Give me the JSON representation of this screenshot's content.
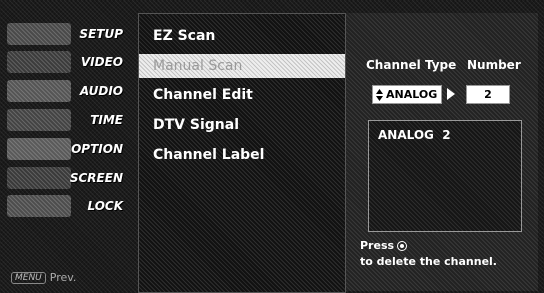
{
  "menu": {
    "items": [
      {
        "label": "SETUP"
      },
      {
        "label": "VIDEO"
      },
      {
        "label": "AUDIO"
      },
      {
        "label": "TIME"
      },
      {
        "label": "OPTION"
      },
      {
        "label": "SCREEN"
      },
      {
        "label": "LOCK"
      }
    ],
    "prev_key": "MENU",
    "prev_label": "Prev."
  },
  "submenu": {
    "items": [
      {
        "label": "EZ Scan"
      },
      {
        "label": "Manual Scan",
        "selected": true
      },
      {
        "label": "Channel Edit"
      },
      {
        "label": "DTV Signal"
      },
      {
        "label": "Channel Label"
      }
    ]
  },
  "manual_scan": {
    "channel_type_label": "Channel Type",
    "number_label": "Number",
    "channel_type_value": "ANALOG",
    "number_value": "2",
    "display_text": "ANALOG  2",
    "help_press": "Press",
    "help_action": "to delete the channel."
  },
  "colors": {
    "highlight": "#eeeeee",
    "text": "#ffffff"
  }
}
